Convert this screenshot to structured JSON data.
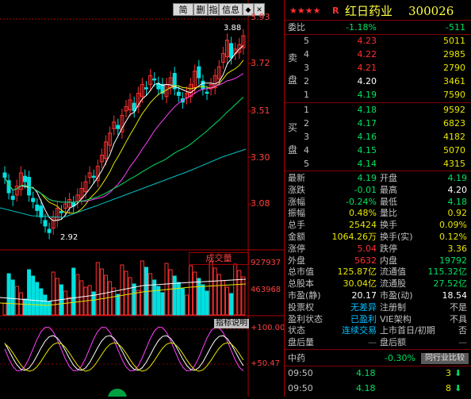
{
  "toolbar": {
    "b1": "简",
    "b2": "删",
    "b3": "指",
    "b4": "信息",
    "b5": "◆",
    "b6": "✕"
  },
  "price_axis": [
    "3.93",
    "3.72",
    "3.51",
    "3.30",
    "3.08"
  ],
  "price_marks": {
    "high": "3.88",
    "low": "2.92"
  },
  "vol_axis": [
    "927937",
    "463968"
  ],
  "vol_label": "成交量",
  "ind_label": "指标说明",
  "ind_axis": [
    "+100.00",
    "+50.47"
  ],
  "header": {
    "stars": "★★★★",
    "r": "R",
    "name": "红日药业",
    "code": "300026"
  },
  "weibi": {
    "label": "委比",
    "pct": "-1.18%",
    "val": "-511"
  },
  "sell_label": [
    "卖",
    "盘"
  ],
  "buy_label": [
    "买",
    "盘"
  ],
  "sells": [
    {
      "n": "5",
      "p": "4.23",
      "v": "5011"
    },
    {
      "n": "4",
      "p": "4.22",
      "v": "2985"
    },
    {
      "n": "3",
      "p": "4.21",
      "v": "2790"
    },
    {
      "n": "2",
      "p": "4.20",
      "v": "3461"
    },
    {
      "n": "1",
      "p": "4.19",
      "v": "7590"
    }
  ],
  "buys": [
    {
      "n": "1",
      "p": "4.18",
      "v": "9592"
    },
    {
      "n": "2",
      "p": "4.17",
      "v": "6823"
    },
    {
      "n": "3",
      "p": "4.16",
      "v": "4182"
    },
    {
      "n": "4",
      "p": "4.15",
      "v": "5070"
    },
    {
      "n": "5",
      "p": "4.14",
      "v": "4315"
    }
  ],
  "stats": [
    {
      "l1": "最新",
      "v1": "4.19",
      "l2": "开盘",
      "v2": "4.19"
    },
    {
      "l1": "涨跌",
      "v1": "-0.01",
      "l2": "最高",
      "v2": "4.20"
    },
    {
      "l1": "涨幅",
      "v1": "-0.24%",
      "l2": "最低",
      "v2": "4.18"
    },
    {
      "l1": "振幅",
      "v1": "0.48%",
      "l2": "量比",
      "v2": "0.92"
    },
    {
      "l1": "总手",
      "v1": "25424",
      "l2": "换手",
      "v2": "0.09%"
    },
    {
      "l1": "金额",
      "v1": "1064.26万",
      "l2": "换手(实)",
      "v2": "0.12%"
    },
    {
      "l1": "涨停",
      "v1": "5.04",
      "l2": "跌停",
      "v2": "3.36"
    },
    {
      "l1": "外盘",
      "v1": "5632",
      "l2": "内盘",
      "v2": "19792"
    },
    {
      "l1": "总市值",
      "v1": "125.87亿",
      "l2": "流通值",
      "v2": "115.32亿"
    },
    {
      "l1": "总股本",
      "v1": "30.04亿",
      "l2": "流通股",
      "v2": "27.52亿"
    },
    {
      "l1": "市盈(静)",
      "v1": "20.17",
      "l2": "市盈(动)",
      "v2": "18.54"
    },
    {
      "l1": "投票权",
      "v1": "无差异",
      "l2": "注册制",
      "v2": "不是"
    },
    {
      "l1": "盈利状态",
      "v1": "已盈利",
      "l2": "VIE架构",
      "v2": "不具"
    },
    {
      "l1": "状态",
      "v1": "连续交易",
      "l2": "上市首日/初期",
      "v2": "否"
    },
    {
      "l1": "盘后量",
      "v1": "—",
      "l2": "盘后额",
      "v2": "—"
    }
  ],
  "sector": {
    "name": "中药",
    "pct": "-0.30%",
    "btn": "同行业比较"
  },
  "ticks": [
    {
      "t": "09:50",
      "p": "4.18",
      "v": "3",
      "arrow": "down"
    },
    {
      "t": "09:50",
      "p": "4.18",
      "v": "8",
      "arrow": "down"
    }
  ]
}
